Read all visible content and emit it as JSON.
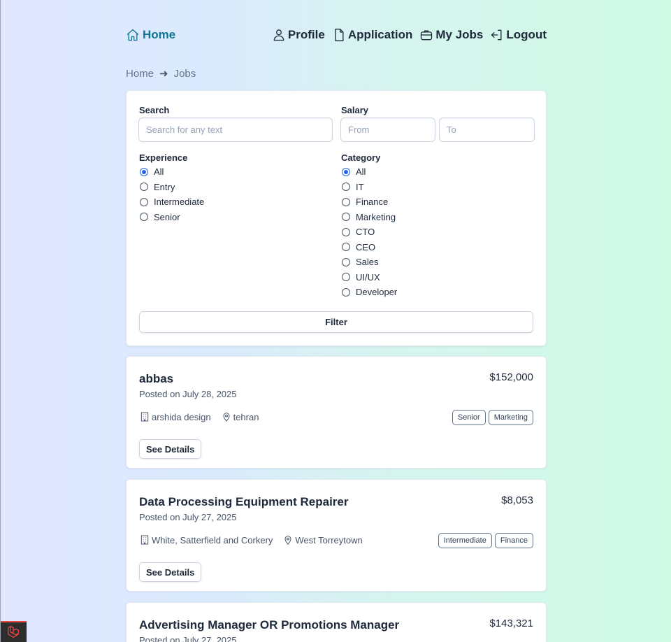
{
  "nav": {
    "home": "Home",
    "profile": "Profile",
    "application": "Application",
    "my_jobs": "My Jobs",
    "logout": "Logout"
  },
  "breadcrumb": {
    "home": "Home",
    "current": "Jobs"
  },
  "filters": {
    "search_label": "Search",
    "search_placeholder": "Search for any text",
    "salary_label": "Salary",
    "salary_from_placeholder": "From",
    "salary_to_placeholder": "To",
    "experience_label": "Experience",
    "experience_options": [
      "All",
      "Entry",
      "Intermediate",
      "Senior"
    ],
    "experience_selected": "All",
    "category_label": "Category",
    "category_options": [
      "All",
      "IT",
      "Finance",
      "Marketing",
      "CTO",
      "CEO",
      "Sales",
      "UI/UX",
      "Developer"
    ],
    "category_selected": "All",
    "filter_button": "Filter"
  },
  "jobs": [
    {
      "title": "abbas",
      "salary": "$152,000",
      "posted": "Posted on July 28, 2025",
      "company": "arshida design",
      "location": "tehran",
      "tags": [
        "Senior",
        "Marketing"
      ],
      "button": "See Details"
    },
    {
      "title": "Data Processing Equipment Repairer",
      "salary": "$8,053",
      "posted": "Posted on July 27, 2025",
      "company": "White, Satterfield and Corkery",
      "location": "West Torreytown",
      "tags": [
        "Intermediate",
        "Finance"
      ],
      "button": "See Details"
    },
    {
      "title": "Advertising Manager OR Promotions Manager",
      "salary": "$143,321",
      "posted": "Posted on July 27, 2025"
    }
  ],
  "colors": {
    "accent": "#0e7490",
    "radio_checked": "#2563eb",
    "text": "#1e293b"
  }
}
